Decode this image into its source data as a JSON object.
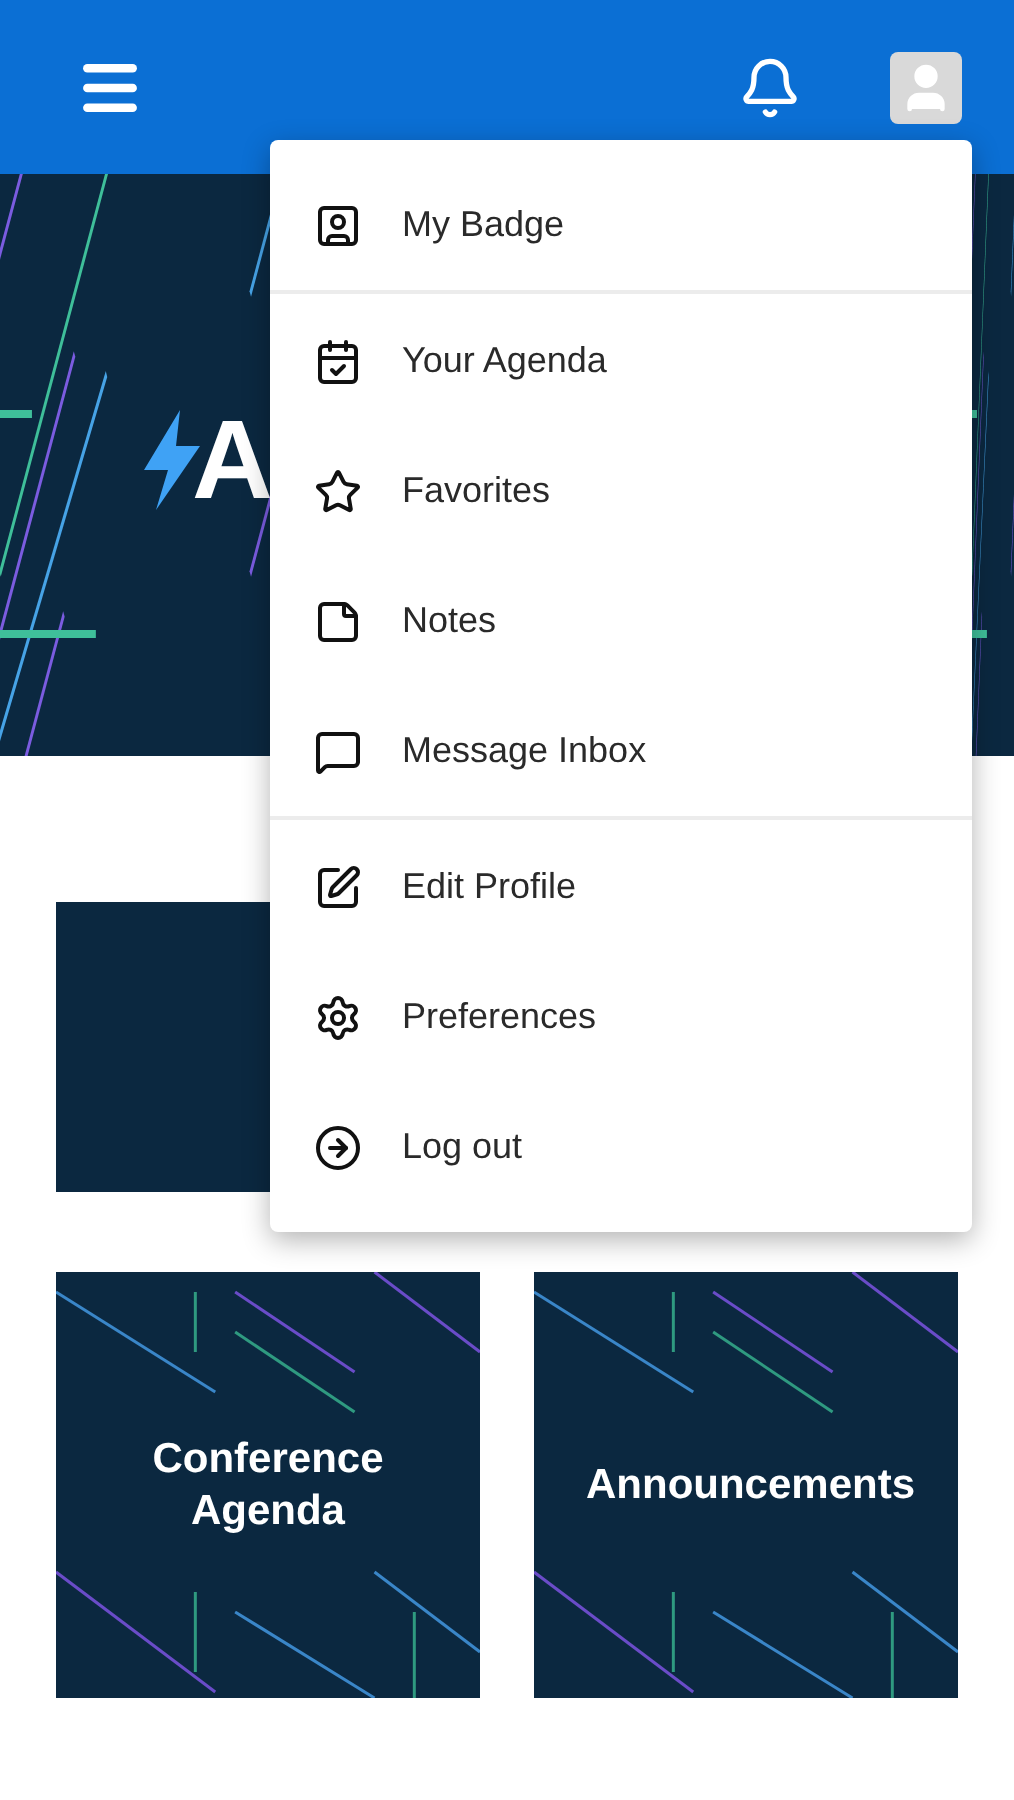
{
  "banner": {
    "text": "A"
  },
  "menu": {
    "sections": [
      [
        {
          "label": "My Badge"
        }
      ],
      [
        {
          "label": "Your Agenda"
        },
        {
          "label": "Favorites"
        },
        {
          "label": "Notes"
        },
        {
          "label": "Message Inbox"
        }
      ],
      [
        {
          "label": "Edit Profile"
        },
        {
          "label": "Preferences"
        },
        {
          "label": "Log out"
        }
      ]
    ]
  },
  "tiles": [
    {
      "label": "Conference Agenda"
    },
    {
      "label": "Announcements"
    }
  ]
}
